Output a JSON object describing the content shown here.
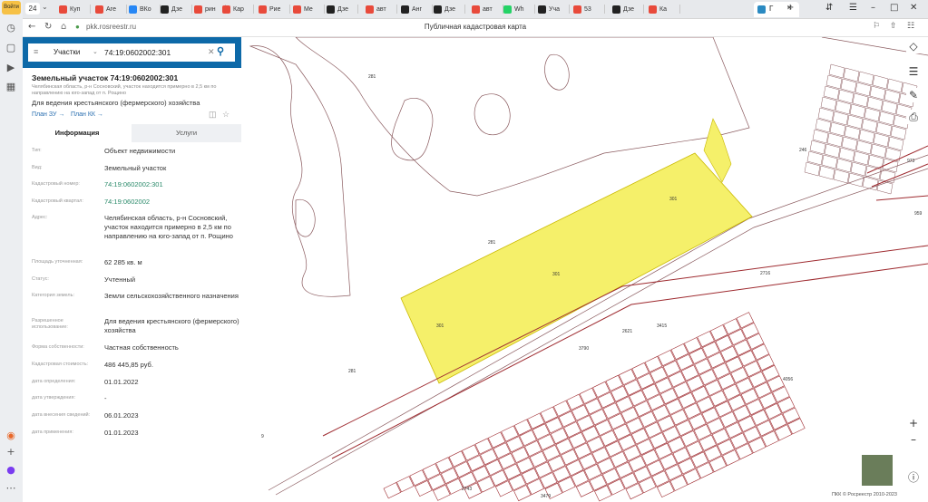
{
  "browser": {
    "yandex_button": "Войти",
    "tab_count": "24",
    "tabs": [
      {
        "label": "Куп",
        "color": "#e84a3b"
      },
      {
        "label": "Аге",
        "color": "#e84a3b"
      },
      {
        "label": "ВКо",
        "color": "#2787f5"
      },
      {
        "label": "Дзе",
        "color": "#222222"
      },
      {
        "label": "рин",
        "color": "#e84a3b"
      },
      {
        "label": "Кар",
        "color": "#e84a3b"
      },
      {
        "label": "Рие",
        "color": "#e84a3b"
      },
      {
        "label": "Ме",
        "color": "#e84a3b"
      },
      {
        "label": "Дзе",
        "color": "#222222"
      },
      {
        "label": "авт",
        "color": "#e84a3b"
      },
      {
        "label": "Анг",
        "color": "#222222"
      },
      {
        "label": "Дзе",
        "color": "#222222"
      },
      {
        "label": "авт",
        "color": "#e84a3b"
      },
      {
        "label": "Wh",
        "color": "#25d366"
      },
      {
        "label": "Уча",
        "color": "#222222"
      },
      {
        "label": "53",
        "color": "#e84a3b"
      },
      {
        "label": "Дзе",
        "color": "#222222"
      },
      {
        "label": "Ка",
        "color": "#e84a3b"
      },
      {
        "label": "Г",
        "color": "#2a8ac2"
      }
    ],
    "url": "pkk.rosreestr.ru",
    "page_title": "Публичная кадастровая карта"
  },
  "search": {
    "type": "Участки",
    "value": "74:19:0602002:301"
  },
  "object": {
    "title": "Земельный участок 74:19:0602002:301",
    "subtitle": "Челябинская область, р-н Сосновский, участок находится примерно в 2,5 км по направлению на юго-запад от п. Рощино",
    "use": "Для ведения крестьянского (фермерского) хозяйства",
    "plan_zu": "План ЗУ →",
    "plan_kk": "План КК →",
    "tab_info": "Информация",
    "tab_services": "Услуги"
  },
  "info_rows": [
    {
      "label": "Тип:",
      "value": "Объект недвижимости"
    },
    {
      "label": "Вид:",
      "value": "Земельный участок"
    },
    {
      "label": "Кадастровый номер:",
      "value": "74:19:0602002:301",
      "link": true
    },
    {
      "label": "Кадастровый квартал:",
      "value": "74:19:0602002",
      "link": true
    },
    {
      "label": "Адрес:",
      "value": "Челябинская область, р-н Сосновский, участок находится примерно в 2,5 км по направлению на юго-запад от п. Рощино"
    },
    {
      "label": "Площадь уточненная:",
      "value": "62 285 кв. м"
    },
    {
      "label": "Статус:",
      "value": "Учтенный"
    },
    {
      "label": "Категория земель:",
      "value": "Земли сельскохозяйственного назначения"
    },
    {
      "label": "Разрешенное использование:",
      "value": "Для ведения крестьянского (фермерского) хозяйства"
    },
    {
      "label": "Форма собственности:",
      "value": "Частная собственность"
    },
    {
      "label": "Кадастровая стоимость:",
      "value": "486 445,85 руб."
    },
    {
      "label": "дата определения:",
      "value": "01.01.2022"
    },
    {
      "label": "дата утверждения:",
      "value": "-"
    },
    {
      "label": "дата внесения сведений:",
      "value": "06.01.2023"
    },
    {
      "label": "дата применения:",
      "value": "01.01.2023"
    }
  ],
  "map": {
    "labels": [
      "281",
      "246",
      "301",
      "281",
      "301",
      "301",
      "281",
      "9",
      "2716",
      "2621",
      "3790",
      "973",
      "959",
      "4056",
      "2743",
      "3479",
      "3415"
    ],
    "copyright": "ПКК © Росреестр 2010-2023",
    "colors": {
      "selected": "#f5f06a",
      "parcel_line": "#9e2a2f",
      "thin_line": "#8a5a5e"
    }
  }
}
